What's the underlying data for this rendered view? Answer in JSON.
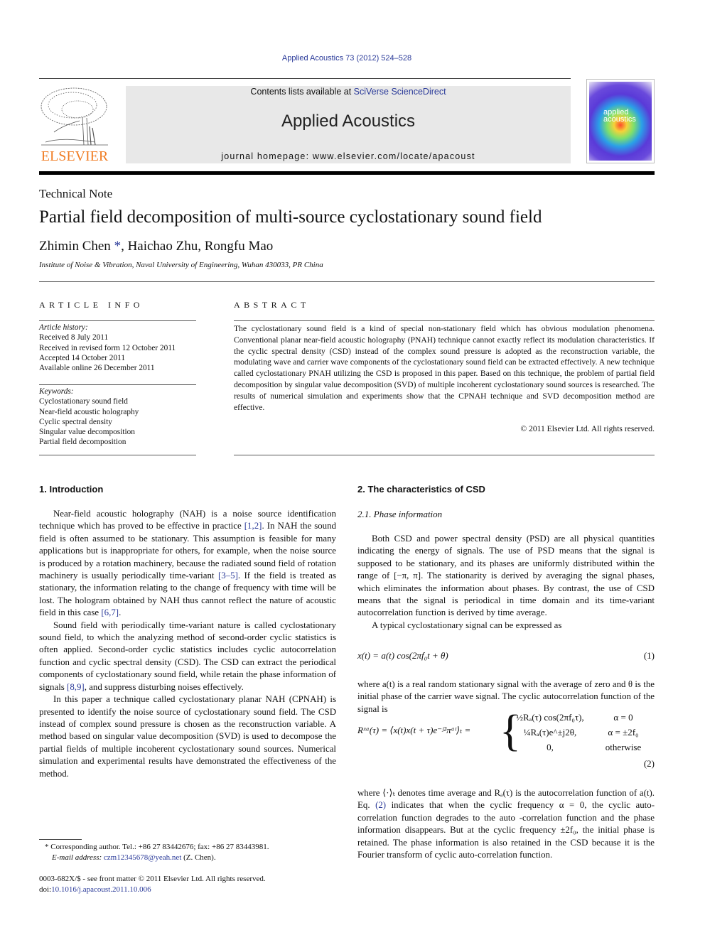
{
  "header": {
    "journal_ref": "Applied Acoustics 73 (2012) 524–528",
    "contents_prefix": "Contents lists available at ",
    "contents_link": "SciVerse ScienceDirect",
    "journal_title": "Applied Acoustics",
    "homepage_prefix": "journal homepage: ",
    "homepage_url": "www.elsevier.com/locate/apacoust",
    "publisher_logo_text": "ELSEVIER",
    "cover_text_line1": "applied",
    "cover_text_line2": "acoustics",
    "colors": {
      "link": "#2a3a99",
      "elsevier_orange": "#f07c22",
      "masthead_bg": "#e8e8e8"
    }
  },
  "article": {
    "type": "Technical Note",
    "title": "Partial field decomposition of multi-source cyclostationary sound field",
    "authors": [
      {
        "name": "Zhimin Chen",
        "marker": "*"
      },
      {
        "name": "Haichao Zhu",
        "marker": ""
      },
      {
        "name": "Rongfu Mao",
        "marker": ""
      }
    ],
    "affiliation": "Institute of Noise & Vibration, Naval University of Engineering, Wuhan 430033, PR China"
  },
  "article_info": {
    "heading": "ARTICLE INFO",
    "history_label": "Article history:",
    "history": [
      "Received 8 July 2011",
      "Received in revised form 12 October 2011",
      "Accepted 14 October 2011",
      "Available online 26 December 2011"
    ],
    "keywords_label": "Keywords:",
    "keywords": [
      "Cyclostationary sound field",
      "Near-field acoustic holography",
      "Cyclic spectral density",
      "Singular value decomposition",
      "Partial field decomposition"
    ]
  },
  "abstract": {
    "heading": "ABSTRACT",
    "text": "The cyclostationary sound field is a kind of special non-stationary field which has obvious modulation phenomena. Conventional planar near-field acoustic holography (PNAH) technique cannot exactly reflect its modulation characteristics. If the cyclic spectral density (CSD) instead of the complex sound pressure is adopted as the reconstruction variable, the modulating wave and carrier wave components of the cyclostationary sound field can be extracted effectively. A new technique called cyclostationary PNAH utilizing the CSD is proposed in this paper. Based on this technique, the problem of partial field decomposition by singular value decomposition (SVD) of multiple incoherent cyclostationary sound sources is researched. The results of numerical simulation and experiments show that the CPNAH technique and SVD decomposition method are effective.",
    "copyright": "© 2011 Elsevier Ltd. All rights reserved."
  },
  "section1": {
    "heading": "1. Introduction",
    "p1": [
      "Near-field acoustic holography (NAH) is a noise source identification technique which has proved to be effective in practice ",
      "[1,2]",
      ". In NAH the sound field is often assumed to be stationary. This assumption is feasible for many applications but is inappropriate for others, for example, when the noise source is produced by a rotation machinery, because the radiated sound field of rotation machinery is usually periodically time-variant ",
      "[3–5]",
      ". If the field is treated as stationary, the information relating to the change of frequency with time will be lost. The hologram obtained by NAH thus cannot reflect the nature of acoustic field in this case ",
      "[6,7]",
      "."
    ],
    "p2": [
      "Sound field with periodically time-variant nature is called cyclostationary sound field, to which the analyzing method of second-order cyclic statistics is often applied. Second-order cyclic statistics includes cyclic autocorrelation function and cyclic spectral density (CSD). The CSD can extract the periodical components of cyclostationary sound field, while retain the phase information of signals ",
      "[8,9]",
      ", and suppress disturbing noises effectively."
    ],
    "p3": "In this paper a technique called cyclostationary planar NAH (CPNAH) is presented to identify the noise source of cyclostationary sound field. The CSD instead of complex sound pressure is chosen as the reconstruction variable. A method based on singular value decomposition (SVD) is used to decompose the partial fields of multiple incoherent cyclostationary sound sources. Numerical simulation and experimental results have demonstrated the effectiveness of the method."
  },
  "footnotes": {
    "corresponding": "* Corresponding author. Tel.: +86 27 83442676; fax: +86 27 83443981.",
    "email_label": "E-mail address: ",
    "email": "czm12345678@yeah.net",
    "email_suffix": " (Z. Chen).",
    "front_matter": "0003-682X/$ - see front matter © 2011 Elsevier Ltd. All rights reserved.",
    "doi_prefix": "doi:",
    "doi": "10.1016/j.apacoust.2011.10.006"
  },
  "section2": {
    "heading": "2. The characteristics of CSD",
    "sub_heading": "2.1. Phase information",
    "p1": "Both CSD and power spectral density (PSD) are all physical quantities indicating the energy of signals. The use of PSD means that the signal is supposed to be stationary, and its phases are uniformly distributed within the range of [−π, π]. The stationarity is derived by averaging the signal phases, which eliminates the information about phases. By contrast, the use of CSD means that the signal is periodical in time domain and its time-variant autocorrelation function is derived by time average.",
    "p2": "A typical cyclostationary signal can be expressed as",
    "eq1": "x(t) = a(t) cos(2πf₀t + θ)",
    "eq1_num": "(1)",
    "p3": "where a(t) is a real random stationary signal with the average of zero and θ is the initial phase of the carrier wave signal. The cyclic autocorrelation function of the signal is",
    "eq2_lhs": "Rˣᵅ(τ) = ⟨x(t)x(t + τ)e⁻ʲ²πᵅᵗ⟩ₜ =",
    "eq2_cases": [
      {
        "expr": "½Rₐ(τ) cos(2πf₀τ),",
        "cond": "α = 0"
      },
      {
        "expr": "¼Rₐ(τ)e^±j2θ,",
        "cond": "α = ±2f₀"
      },
      {
        "expr": "0,",
        "cond": "otherwise"
      }
    ],
    "eq2_num": "(2)",
    "p4": [
      "where ⟨·⟩ₜ denotes time average and Rₐ(τ) is the autocorrelation function of a(t). Eq. ",
      "(2)",
      " indicates that when the cyclic frequency α = 0, the cyclic auto-correlation function degrades to the auto -correlation function and the phase information disappears. But at the cyclic frequency ±2f₀, the initial phase is retained. The phase information is also retained in the CSD because it is the Fourier transform of cyclic auto-correlation function."
    ]
  }
}
